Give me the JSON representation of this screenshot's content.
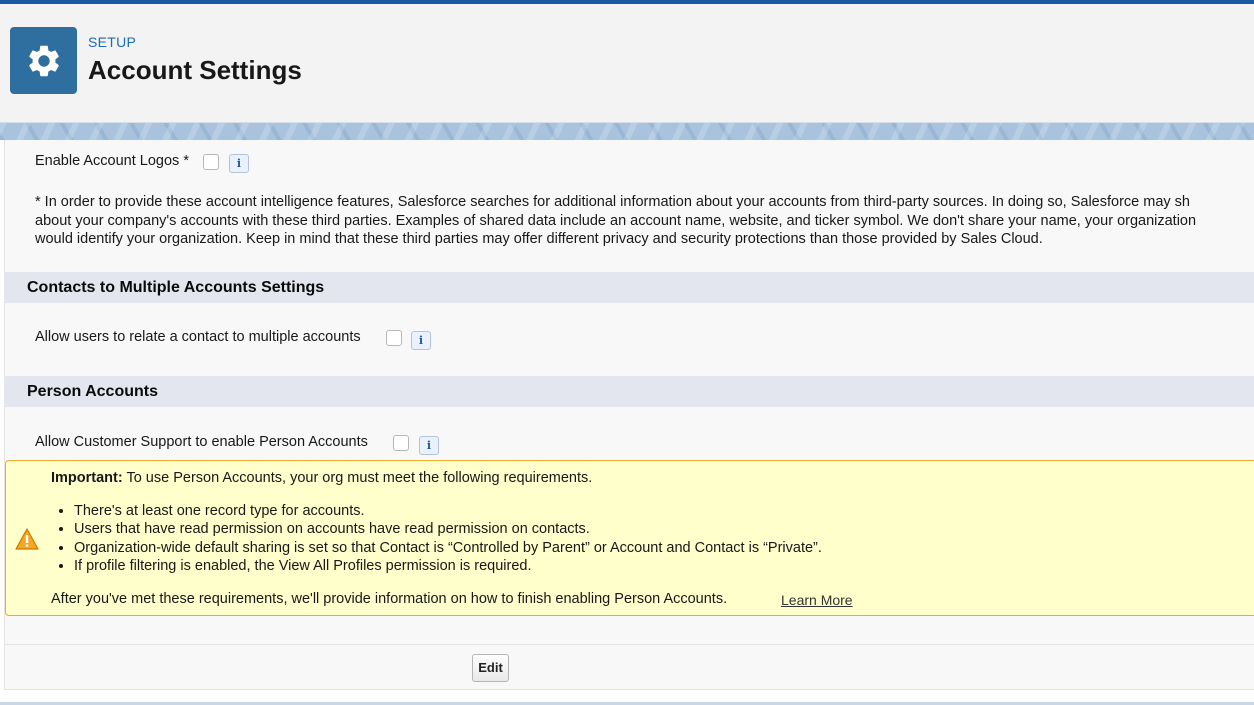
{
  "header": {
    "breadcrumb": "SETUP",
    "title": "Account Settings",
    "icon": "gear-icon"
  },
  "account_logos": {
    "label": "Enable Account Logos *",
    "checked": false
  },
  "disclaimer": {
    "lines": [
      "* In order to provide these account intelligence features, Salesforce searches for additional information about your accounts from third-party sources. In doing so, Salesforce may sh",
      "about your company's accounts with these third parties. Examples of shared data include an account name, website, and ticker symbol. We don't share your name, your organization",
      "would identify your organization. Keep in mind that these third parties may offer different privacy and security protections than those provided by Sales Cloud."
    ]
  },
  "contacts_section": {
    "title": "Contacts to Multiple Accounts Settings",
    "label": "Allow users to relate a contact to multiple accounts",
    "checked": false
  },
  "person_accounts": {
    "title": "Person Accounts",
    "label": "Allow Customer Support to enable Person Accounts",
    "checked": false
  },
  "warning": {
    "icon": "warning-icon",
    "important_label": "Important:",
    "intro": " To use Person Accounts, your org must meet the following requirements.",
    "requirements": [
      "There's at least one record type for accounts.",
      "Users that have read permission on accounts have read permission on contacts.",
      "Organization-wide default sharing is set so that Contact is “Controlled by Parent” or Account and Contact is “Private”.",
      "If profile filtering is enabled, the View All Profiles permission is required."
    ],
    "after": "After you've met these requirements, we'll provide information on how to finish enabling Person Accounts.",
    "learn_more": "Learn More"
  },
  "actions": {
    "edit_label": "Edit"
  },
  "info_glyph": "i",
  "colors": {
    "brand_top": "#1b5aa0",
    "icon_tile": "#2e6fa0",
    "setup_link": "#1b6bb5",
    "section_bg": "#e3e6ef",
    "warning_bg": "#ffffcc",
    "warning_border": "#f0a92e"
  }
}
